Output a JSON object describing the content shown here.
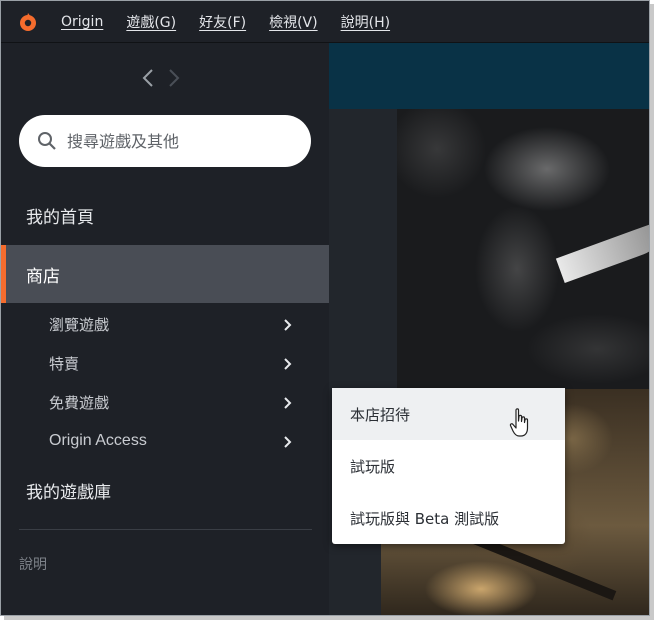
{
  "app": {
    "logo": "origin-logo-icon",
    "accent_color": "#f56c2d"
  },
  "menubar": {
    "items": [
      {
        "label": "Origin"
      },
      {
        "label": "遊戲(G)"
      },
      {
        "label": "好友(F)"
      },
      {
        "label": "檢視(V)"
      },
      {
        "label": "說明(H)"
      }
    ]
  },
  "history": {
    "back_icon": "chevron-left-icon",
    "forward_icon": "chevron-right-icon"
  },
  "search": {
    "placeholder": "搜尋遊戲及其他",
    "value": ""
  },
  "sidebar": {
    "home_label": "我的首頁",
    "store_label": "商店",
    "store_items": [
      {
        "label": "瀏覽遊戲"
      },
      {
        "label": "特賣"
      },
      {
        "label": "免費遊戲"
      },
      {
        "label": "Origin Access"
      }
    ],
    "library_label": "我的遊戲庫",
    "help_label": "說明"
  },
  "dropdown": {
    "items": [
      {
        "label": "本店招待"
      },
      {
        "label": "試玩版"
      },
      {
        "label": "試玩版與 Beta 測試版"
      }
    ]
  }
}
